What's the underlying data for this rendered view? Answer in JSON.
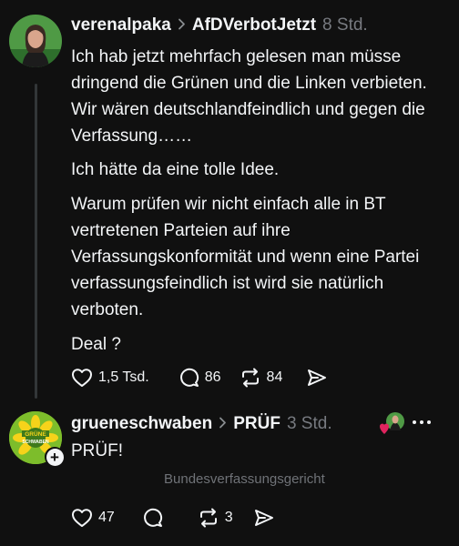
{
  "post1": {
    "username": "verenalpaka",
    "tag": "AfDVerbotJetzt",
    "time": "8 Std.",
    "paragraphs": [
      "Ich hab jetzt mehrfach gelesen man müsse dringend die Grünen und die Linken verbieten. Wir wären deutschlandfeindlich und gegen die Verfassung……",
      "Ich hätte da eine tolle Idee.",
      "Warum prüfen wir nicht einfach alle in BT vertretenen Parteien auf ihre Verfassungskonformität und wenn eine Partei verfassungsfeindlich ist wird sie natürlich verboten.",
      "Deal ?"
    ],
    "likes": "1,5 Tsd.",
    "replies": "86",
    "reposts": "84"
  },
  "post2": {
    "username": "grueneschwaben",
    "tag": "PRÜF",
    "time": "3 Std.",
    "text": "PRÜF!",
    "caption": "Bundesverfassungsgericht",
    "avatar_text_1": "GRÜNE",
    "avatar_text_2": "SCHWABEN",
    "likes": "47",
    "reposts": "3"
  },
  "colors": {
    "background": "#101010",
    "text": "#f3f5f7",
    "muted": "#777a80",
    "green": "#7dbd2b",
    "heart": "#e0245e"
  },
  "icons": [
    "heart-icon",
    "comment-icon",
    "repost-icon",
    "share-icon",
    "more-icon",
    "plus-icon",
    "chevron-right-icon"
  ]
}
